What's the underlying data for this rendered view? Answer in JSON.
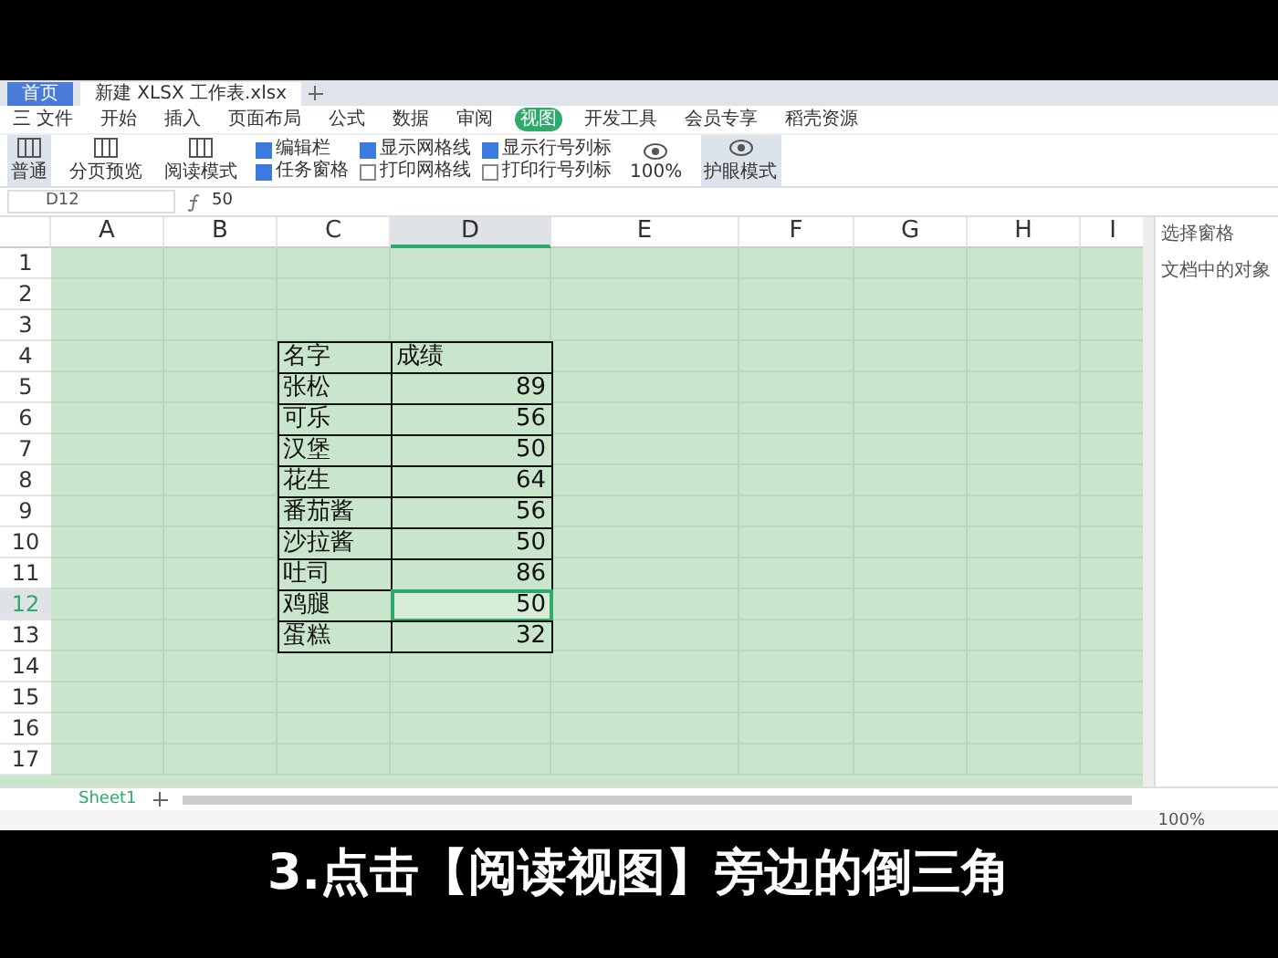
{
  "doc_tabs": [
    {
      "label": "首页",
      "selected": false
    },
    {
      "label": "新建 XLSX 工作表.xlsx",
      "selected": true
    }
  ],
  "menu": [
    {
      "label": "三 文件",
      "selected": false
    },
    {
      "label": "开始",
      "selected": false
    },
    {
      "label": "插入",
      "selected": false
    },
    {
      "label": "页面布局",
      "selected": false
    },
    {
      "label": "公式",
      "selected": false
    },
    {
      "label": "数据",
      "selected": false
    },
    {
      "label": "审阅",
      "selected": false
    },
    {
      "label": "视图",
      "selected": true
    },
    {
      "label": "开发工具",
      "selected": false
    },
    {
      "label": "会员专享",
      "selected": false
    },
    {
      "label": "稻壳资源",
      "selected": false
    }
  ],
  "ribbon_buttons": [
    {
      "label": "普通",
      "selected": true
    },
    {
      "label": "分页预览",
      "selected": false
    },
    {
      "label": "阅读模式",
      "selected": false
    }
  ],
  "view_options": [
    {
      "label": "编辑栏",
      "checked": true
    },
    {
      "label": "显示网格线",
      "checked": true
    },
    {
      "label": "显示行号列标",
      "checked": true
    },
    {
      "label": "任务窗格",
      "checked": true
    },
    {
      "label": "打印网格线",
      "checked": false
    },
    {
      "label": "打印行号列标",
      "checked": false
    }
  ],
  "ribbon_tools": [
    {
      "label": "100%",
      "selected": false
    },
    {
      "label": "护眼模式",
      "selected": true
    }
  ],
  "name_box": "D12",
  "formula": "50",
  "columns": [
    {
      "label": "A",
      "selected": false
    },
    {
      "label": "B",
      "selected": false
    },
    {
      "label": "C",
      "selected": false
    },
    {
      "label": "D",
      "selected": true
    },
    {
      "label": "E",
      "selected": false
    },
    {
      "label": "F",
      "selected": false
    },
    {
      "label": "G",
      "selected": false
    },
    {
      "label": "H",
      "selected": false
    },
    {
      "label": "I",
      "selected": false
    }
  ],
  "rows": [
    {
      "label": "1",
      "selected": false
    },
    {
      "label": "2",
      "selected": false
    },
    {
      "label": "3",
      "selected": false
    },
    {
      "label": "4",
      "selected": false
    },
    {
      "label": "5",
      "selected": false
    },
    {
      "label": "6",
      "selected": false
    },
    {
      "label": "7",
      "selected": false
    },
    {
      "label": "8",
      "selected": false
    },
    {
      "label": "9",
      "selected": false
    },
    {
      "label": "10",
      "selected": false
    },
    {
      "label": "11",
      "selected": false
    },
    {
      "label": "12",
      "selected": true
    },
    {
      "label": "13",
      "selected": false
    },
    {
      "label": "14",
      "selected": false
    },
    {
      "label": "15",
      "selected": false
    },
    {
      "label": "16",
      "selected": false
    },
    {
      "label": "17",
      "selected": false
    }
  ],
  "table": {
    "header": [
      "名字",
      "成绩"
    ],
    "rows": [
      {
        "name": "张松",
        "score": "89",
        "selected": false
      },
      {
        "name": "可乐",
        "score": "56",
        "selected": false
      },
      {
        "name": "汉堡",
        "score": "50",
        "selected": false
      },
      {
        "name": "花生",
        "score": "64",
        "selected": false
      },
      {
        "name": "番茄酱",
        "score": "56",
        "selected": false
      },
      {
        "name": "沙拉酱",
        "score": "50",
        "selected": false
      },
      {
        "name": "吐司",
        "score": "86",
        "selected": false
      },
      {
        "name": "鸡腿",
        "score": "50",
        "selected": true
      },
      {
        "name": "蛋糕",
        "score": "32",
        "selected": false
      }
    ]
  },
  "sheet_tabs": [
    {
      "label": "Sheet1",
      "selected": true
    }
  ],
  "side_pane": {
    "title": "选择窗格",
    "item": "文档中的对象"
  },
  "zoom": "100%",
  "caption": "3.点击【阅读视图】旁边的倒三角"
}
